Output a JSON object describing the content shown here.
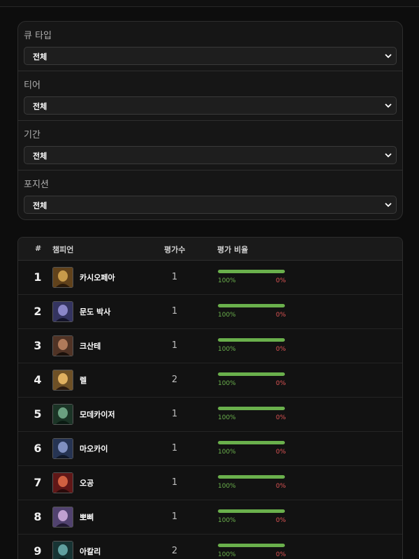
{
  "filters": [
    {
      "label": "큐 타입",
      "value": "전체"
    },
    {
      "label": "티어",
      "value": "전체"
    },
    {
      "label": "기간",
      "value": "전체"
    },
    {
      "label": "포지션",
      "value": "전체"
    }
  ],
  "table": {
    "headers": {
      "rank": "#",
      "champion": "챔피언",
      "count": "평가수",
      "ratio": "평가 비율"
    },
    "rows": [
      {
        "rank": "1",
        "name": "카시오페아",
        "count": "1",
        "good": "100%",
        "bad": "0%",
        "good_fraction": 1.0,
        "thumb_colors": [
          "#6b4a1e",
          "#c79a4a",
          "#2a1a0a"
        ]
      },
      {
        "rank": "2",
        "name": "문도 박사",
        "count": "1",
        "good": "100%",
        "bad": "0%",
        "good_fraction": 1.0,
        "thumb_colors": [
          "#3a3a6a",
          "#8a86c8",
          "#14142a"
        ]
      },
      {
        "rank": "3",
        "name": "크산테",
        "count": "1",
        "good": "100%",
        "bad": "0%",
        "good_fraction": 1.0,
        "thumb_colors": [
          "#5a3a2a",
          "#b07a5a",
          "#1a100a"
        ]
      },
      {
        "rank": "4",
        "name": "렐",
        "count": "2",
        "good": "100%",
        "bad": "0%",
        "good_fraction": 1.0,
        "thumb_colors": [
          "#7a5a2a",
          "#e0b060",
          "#2a1a10"
        ]
      },
      {
        "rank": "5",
        "name": "모데카이저",
        "count": "1",
        "good": "100%",
        "bad": "0%",
        "good_fraction": 1.0,
        "thumb_colors": [
          "#1e3a2a",
          "#6aa080",
          "#0a1a12"
        ]
      },
      {
        "rank": "6",
        "name": "마오카이",
        "count": "1",
        "good": "100%",
        "bad": "0%",
        "good_fraction": 1.0,
        "thumb_colors": [
          "#2a3a5a",
          "#8090c0",
          "#101828"
        ]
      },
      {
        "rank": "7",
        "name": "오공",
        "count": "1",
        "good": "100%",
        "bad": "0%",
        "good_fraction": 1.0,
        "thumb_colors": [
          "#6a1a1a",
          "#d06040",
          "#2a0a0a"
        ]
      },
      {
        "rank": "8",
        "name": "뽀삐",
        "count": "1",
        "good": "100%",
        "bad": "0%",
        "good_fraction": 1.0,
        "thumb_colors": [
          "#5a4a7a",
          "#c0a0d0",
          "#201830"
        ]
      },
      {
        "rank": "9",
        "name": "아칼리",
        "count": "2",
        "good": "100%",
        "bad": "0%",
        "good_fraction": 1.0,
        "thumb_colors": [
          "#1a3a3a",
          "#60a0a0",
          "#0a1a1a"
        ]
      }
    ]
  },
  "colors": {
    "positive": "#6ab04c",
    "negative": "#e05555",
    "background": "#0d0d0d"
  },
  "icons": {
    "select": "chevron-down-icon"
  }
}
